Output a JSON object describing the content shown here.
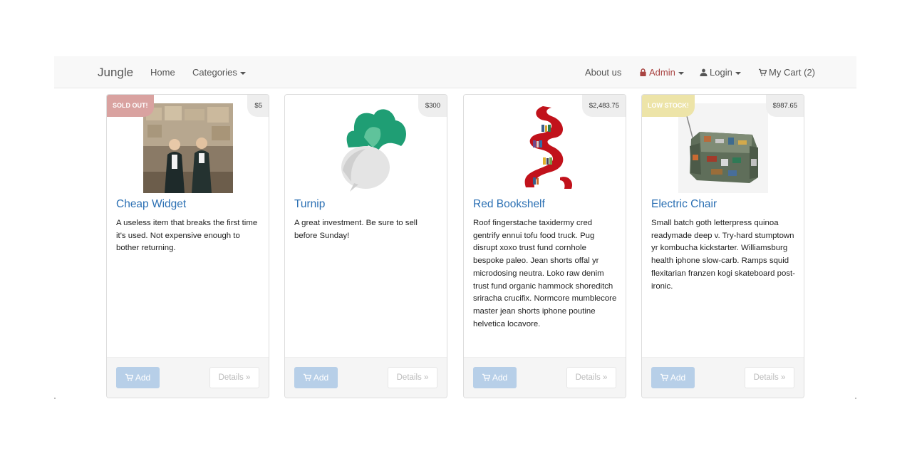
{
  "nav": {
    "brand": "Jungle",
    "home": "Home",
    "categories": "Categories",
    "about": "About us",
    "admin": "Admin",
    "login": "Login",
    "cart": "My Cart (2)",
    "icons": {
      "admin": "lock-icon",
      "login": "user-icon",
      "cart": "cart-icon"
    },
    "admin_color": "#a94442"
  },
  "products": [
    {
      "ribbon": "SOLD OUT!",
      "price": "$5",
      "name": "Cheap Widget",
      "description": "A useless item that breaks the first time it's used. Not expensive enough to bother returning.",
      "image": "people-in-warehouse-photo",
      "add_label": "Add",
      "details_label": "Details »"
    },
    {
      "ribbon": "",
      "price": "$300",
      "name": "Turnip",
      "description": "A great investment. Be sure to sell before Sunday!",
      "image": "turnip-illustration",
      "add_label": "Add",
      "details_label": "Details »"
    },
    {
      "ribbon": "",
      "price": "$2,483.75",
      "name": "Red Bookshelf",
      "description": "Roof fingerstache taxidermy cred gentrify ennui tofu food truck. Pug disrupt xoxo trust fund cornhole bespoke paleo. Jean shorts offal yr microdosing neutra. Loko raw denim trust fund organic hammock shoreditch sriracha crucifix. Normcore mumblecore master jean shorts iphone poutine helvetica locavore.",
      "image": "red-bookshelf-photo",
      "add_label": "Add",
      "details_label": "Details »"
    },
    {
      "ribbon": "LOW STOCK!",
      "price": "$987.65",
      "name": "Electric Chair",
      "description": "Small batch goth letterpress quinoa readymade deep v. Try-hard stumptown yr kombucha kickstarter. Williamsburg health iphone slow-carb. Ramps squid flexitarian franzen kogi skateboard post-ironic.",
      "image": "circuit-board-armchair-photo",
      "add_label": "Add",
      "details_label": "Details »"
    }
  ]
}
